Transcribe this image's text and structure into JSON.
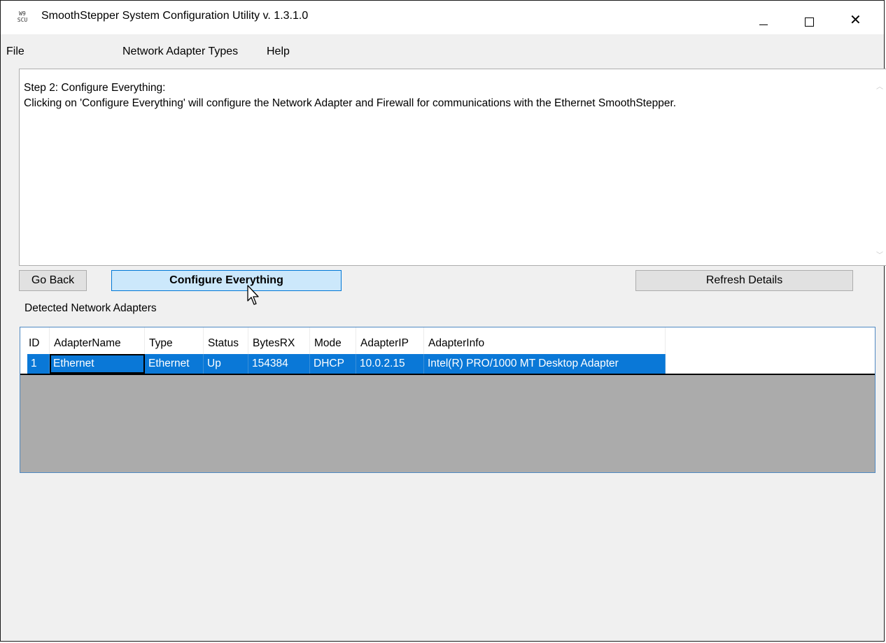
{
  "window": {
    "icon_text": "W9\nSCU",
    "title": "SmoothStepper System Configuration Utility v. 1.3.1.0"
  },
  "menu": {
    "items": [
      {
        "label": "File"
      },
      {
        "label": "Network Adapter Types"
      },
      {
        "label": "Help"
      }
    ]
  },
  "instructions": {
    "line1": "Step 2: Configure Everything:",
    "line2": "Clicking on 'Configure Everything' will configure the Network Adapter and Firewall for communications with the Ethernet SmoothStepper."
  },
  "buttons": {
    "go_back": "Go Back",
    "configure": "Configure Everything",
    "refresh": "Refresh Details"
  },
  "adapters": {
    "label": "Detected Network Adapters",
    "columns": [
      "ID",
      "AdapterName",
      "Type",
      "Status",
      "BytesRX",
      "Mode",
      "AdapterIP",
      "AdapterInfo"
    ],
    "rows": [
      [
        "1",
        "Ethernet",
        "Ethernet",
        "Up",
        "154384",
        "DHCP",
        "10.0.2.15",
        "Intel(R) PRO/1000 MT Desktop Adapter"
      ]
    ]
  },
  "colors": {
    "selection": "#0a78d7",
    "button_hot": "#cce8fb",
    "button_hot_border": "#0078d7",
    "grid_border": "#4f89c2"
  },
  "icons": {
    "minimize": "minimize-icon",
    "maximize": "maximize-icon",
    "close": "close-icon",
    "cursor": "mouse-pointer-icon"
  }
}
